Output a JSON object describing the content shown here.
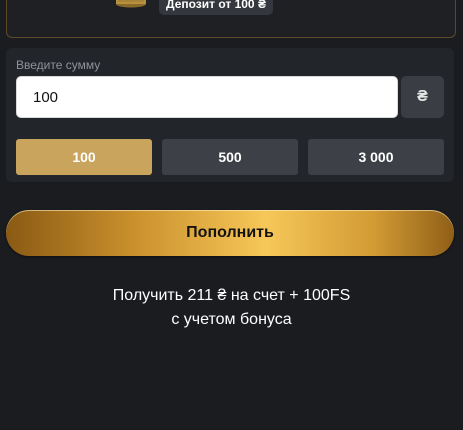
{
  "promo": {
    "icon": "coin-stack-icon",
    "deposit_badge": "Депозит от 100 ₴"
  },
  "amount": {
    "label": "Введите сумму",
    "value": "100",
    "currency_symbol": "₴"
  },
  "presets": [
    {
      "label": "100",
      "selected": true
    },
    {
      "label": "500",
      "selected": false
    },
    {
      "label": "3 000",
      "selected": false
    }
  ],
  "topup_button": "Пополнить",
  "bonus": {
    "line1": "Получить 211 ₴ на счет + 100FS",
    "line2": "с учетом бонуса"
  },
  "colors": {
    "background": "#1a1c20",
    "panel": "#22252a",
    "preset_active": "#c9a45d",
    "preset_inactive": "#3d4046",
    "button_gold": "#f6c759"
  }
}
